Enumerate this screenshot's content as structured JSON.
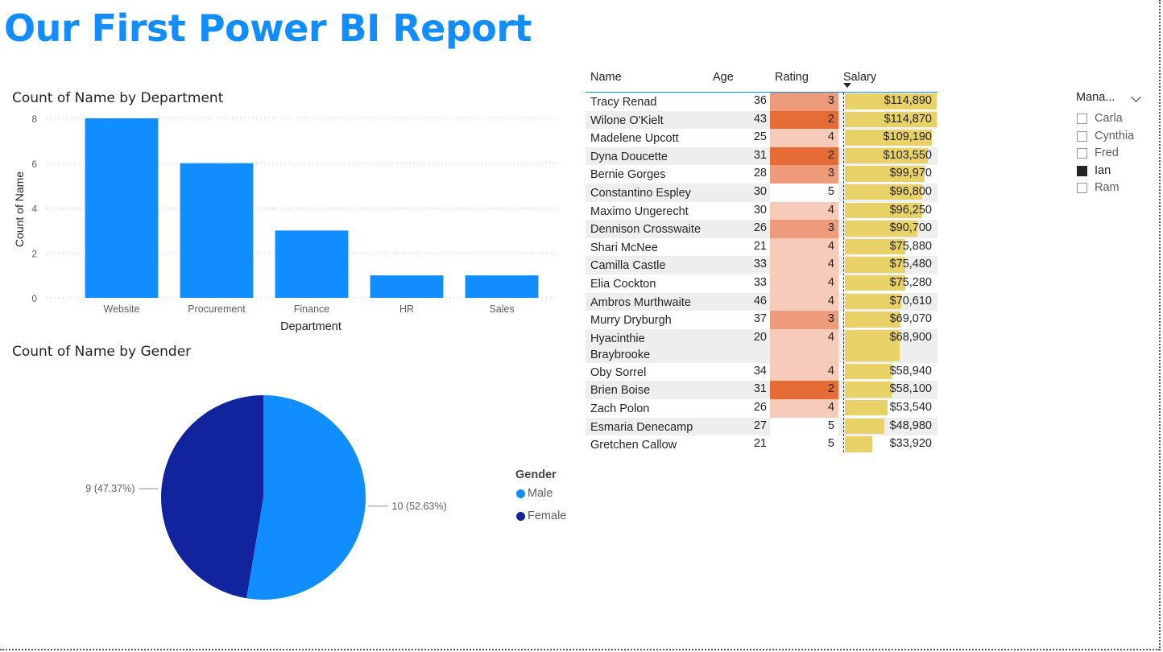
{
  "report": {
    "title": "Our First Power BI Report",
    "title_color": "#118DFF"
  },
  "chart_data": [
    {
      "type": "bar",
      "title": "Count of Name by Department",
      "xlabel": "Department",
      "ylabel": "Count of Name",
      "categories": [
        "Website",
        "Procurement",
        "Finance",
        "HR",
        "Sales"
      ],
      "values": [
        8,
        6,
        3,
        1,
        1
      ],
      "ylim": [
        0,
        8
      ],
      "yticks": [
        "0",
        "2",
        "4",
        "6",
        "8"
      ],
      "grid": true,
      "color": "#118DFF"
    },
    {
      "type": "pie",
      "title": "Count of Name by Gender",
      "legend_title": "Gender",
      "legend_position": "right",
      "slices": [
        {
          "label": "Male",
          "value": 10,
          "data_label": "10 (52.63%)",
          "color": "#118DFF"
        },
        {
          "label": "Female",
          "value": 9,
          "data_label": "9 (47.37%)",
          "color": "#12239E"
        }
      ]
    },
    {
      "type": "table",
      "columns": [
        "Name",
        "Age",
        "Rating",
        "Salary"
      ],
      "sort": {
        "column": "Salary",
        "direction": "descending"
      },
      "rating_colors": {
        "2": "#E66C37",
        "3": "#ED9B7A",
        "4": "#F6CBBA",
        "5": "#FFFFFF"
      },
      "salary_bar_color": "#E8D166",
      "salary_max": 114890,
      "rows": [
        {
          "name": "Tracy Renad",
          "age": "36",
          "rating": 3,
          "salary": 114890,
          "salary_text": "$114,890"
        },
        {
          "name": "Wilone O'Kielt",
          "age": "43",
          "rating": 2,
          "salary": 114870,
          "salary_text": "$114,870"
        },
        {
          "name": "Madelene Upcott",
          "age": "25",
          "rating": 4,
          "salary": 109190,
          "salary_text": "$109,190"
        },
        {
          "name": "Dyna Doucette",
          "age": "31",
          "rating": 2,
          "salary": 103550,
          "salary_text": "$103,550"
        },
        {
          "name": "Bernie Gorges",
          "age": "28",
          "rating": 3,
          "salary": 99970,
          "salary_text": "$99,970"
        },
        {
          "name": "Constantino Espley",
          "age": "30",
          "rating": 5,
          "salary": 96800,
          "salary_text": "$96,800"
        },
        {
          "name": "Maximo Ungerecht",
          "age": "30",
          "rating": 4,
          "salary": 96250,
          "salary_text": "$96,250"
        },
        {
          "name": "Dennison Crosswaite",
          "age": "26",
          "rating": 3,
          "salary": 90700,
          "salary_text": "$90,700"
        },
        {
          "name": "Shari McNee",
          "age": "21",
          "rating": 4,
          "salary": 75880,
          "salary_text": "$75,880"
        },
        {
          "name": "Camilla Castle",
          "age": "33",
          "rating": 4,
          "salary": 75480,
          "salary_text": "$75,480"
        },
        {
          "name": "Elia Cockton",
          "age": "33",
          "rating": 4,
          "salary": 75280,
          "salary_text": "$75,280"
        },
        {
          "name": "Ambros Murthwaite",
          "age": "46",
          "rating": 4,
          "salary": 70610,
          "salary_text": "$70,610"
        },
        {
          "name": "Murry Dryburgh",
          "age": "37",
          "rating": 3,
          "salary": 69070,
          "salary_text": "$69,070"
        },
        {
          "name": "Hyacinthie Braybrooke",
          "age": "20",
          "rating": 4,
          "salary": 68900,
          "salary_text": "$68,900"
        },
        {
          "name": "Oby Sorrel",
          "age": "34",
          "rating": 4,
          "salary": 58940,
          "salary_text": "$58,940"
        },
        {
          "name": "Brien Boise",
          "age": "31",
          "rating": 2,
          "salary": 58100,
          "salary_text": "$58,100"
        },
        {
          "name": "Zach Polon",
          "age": "26",
          "rating": 4,
          "salary": 53540,
          "salary_text": "$53,540"
        },
        {
          "name": "Esmaria Denecamp",
          "age": "27",
          "rating": 5,
          "salary": 48980,
          "salary_text": "$48,980"
        },
        {
          "name": "Gretchen Callow",
          "age": "21",
          "rating": 5,
          "salary": 33920,
          "salary_text": "$33,920"
        }
      ]
    }
  ],
  "slicer": {
    "title": "Mana...",
    "items": [
      {
        "label": "Carla",
        "checked": false
      },
      {
        "label": "Cynthia",
        "checked": false
      },
      {
        "label": "Fred",
        "checked": false
      },
      {
        "label": "Ian",
        "checked": true
      },
      {
        "label": "Ram",
        "checked": false
      }
    ]
  }
}
